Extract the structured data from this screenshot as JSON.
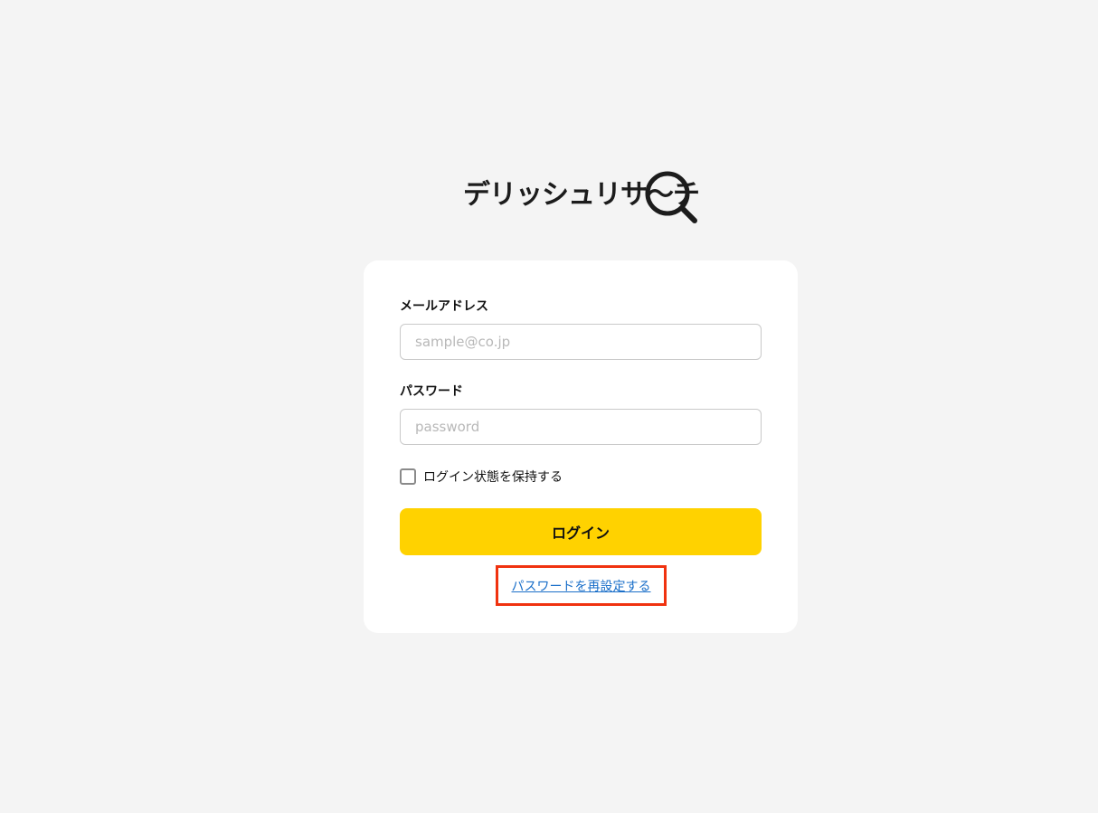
{
  "brand": {
    "name": "デリッシュリサ〜チ",
    "logo_icon": "magnifier-icon"
  },
  "form": {
    "email": {
      "label": "メールアドレス",
      "value": "",
      "placeholder": "sample@co.jp"
    },
    "password": {
      "label": "パスワード",
      "value": "",
      "placeholder": "password"
    },
    "remember": {
      "label": "ログイン状態を保持する",
      "checked": false
    },
    "submit_label": "ログイン",
    "reset_link": "パスワードを再設定する"
  },
  "colors": {
    "background": "#f4f4f4",
    "card": "#ffffff",
    "primary_button": "#ffd200",
    "link": "#1a6fc9",
    "highlight": "#f0320f"
  }
}
